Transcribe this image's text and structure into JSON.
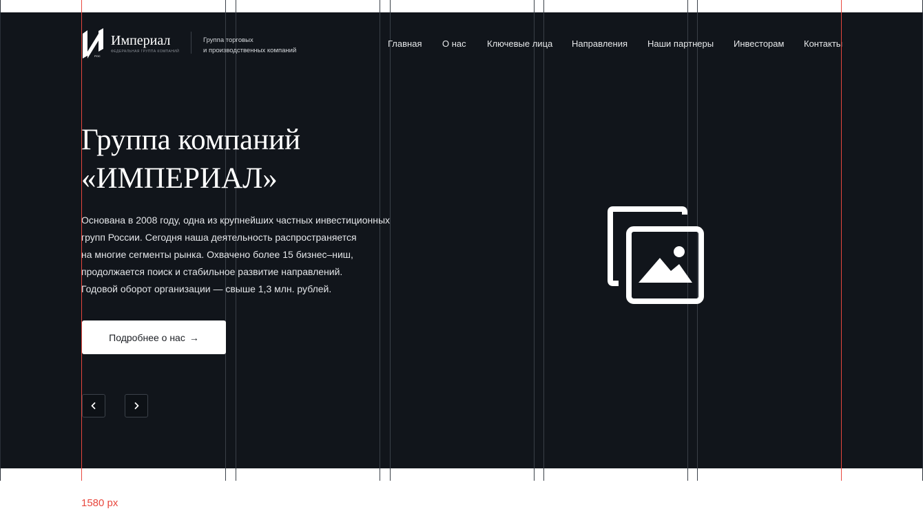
{
  "brand": {
    "name": "Империал",
    "subtitle": "Федеральная группа компаний",
    "mark_caption": "РОС",
    "tagline_line1": "Группа торговых",
    "tagline_line2": "и производственных компаний"
  },
  "nav": {
    "items": [
      "Главная",
      "О нас",
      "Ключевые лица",
      "Направления",
      "Наши партнеры",
      "Инвесторам",
      "Контакты"
    ]
  },
  "hero": {
    "title_line1": "Группа компаний",
    "title_line2": "«ИМПЕРИАЛ»",
    "description_lines": [
      "Основана в 2008 году, одна из крупнейших частных инвестиционных",
      "групп России. Сегодня наша деятельность распространяется",
      "на многие сегменты рынка. Охвачено более 15 бизнес–ниш,",
      "продолжается поиск и стабильное развитие направлений.",
      "Годовой оборот организации — свыше 1,3 млн. рублей."
    ],
    "cta_label": "Подробнее о нас",
    "cta_arrow": "→",
    "prev_icon": "chevron-left-icon",
    "next_icon": "chevron-right-icon",
    "image_icon": "image-gallery-icon"
  },
  "annotation": {
    "width_label": "1580 px"
  },
  "colors": {
    "background": "#11151b",
    "accent_guides": "#e8473d",
    "text": "#ffffff",
    "button": "#ffffff"
  }
}
